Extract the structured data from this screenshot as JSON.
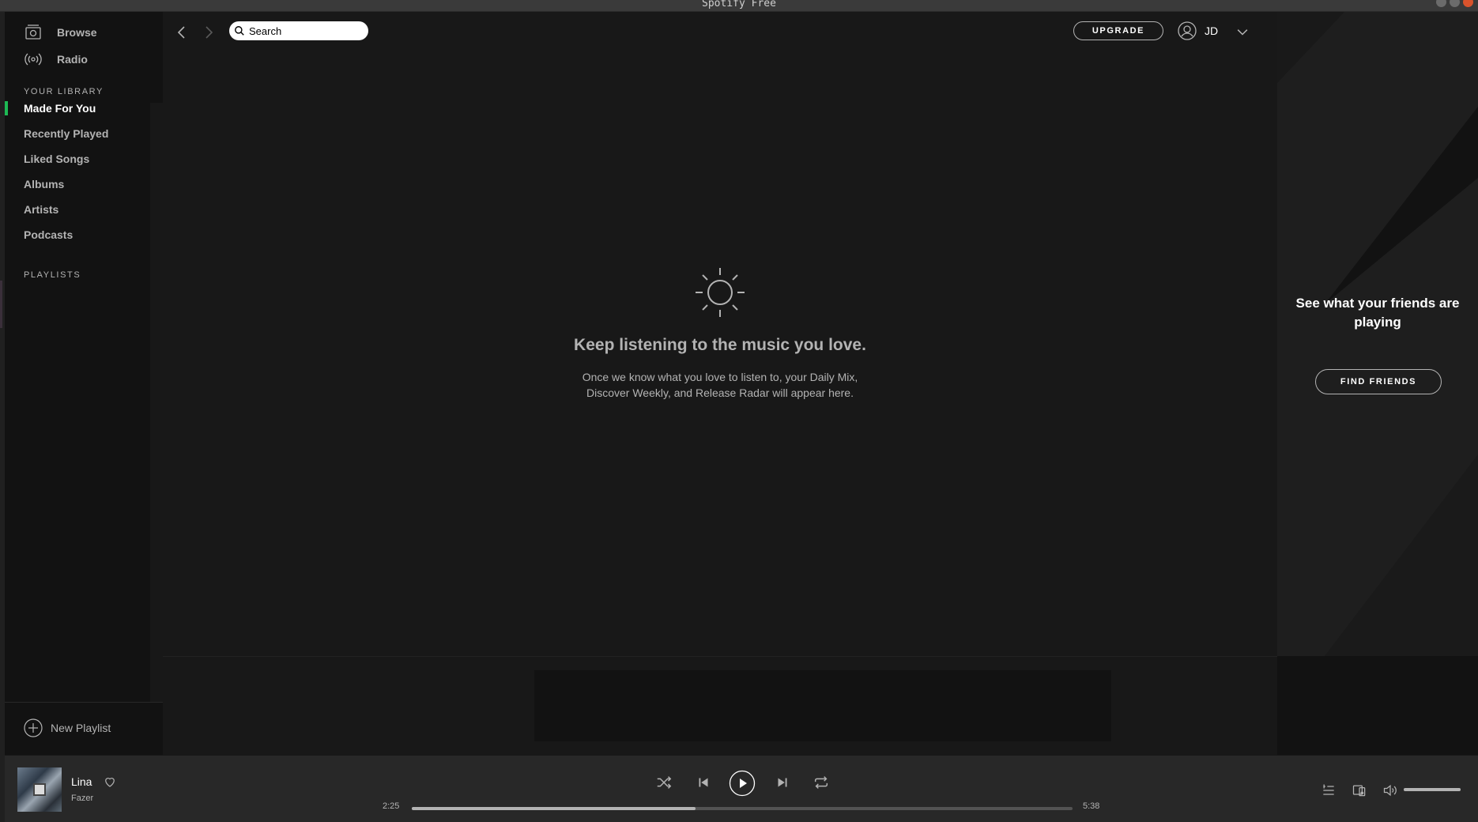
{
  "window": {
    "title": "Spotify Free"
  },
  "sidebar": {
    "nav": [
      {
        "label": "Browse",
        "icon": "browse-icon"
      },
      {
        "label": "Radio",
        "icon": "radio-icon"
      }
    ],
    "library_heading": "YOUR LIBRARY",
    "library_items": [
      {
        "label": "Made For You",
        "active": true
      },
      {
        "label": "Recently Played",
        "active": false
      },
      {
        "label": "Liked Songs",
        "active": false
      },
      {
        "label": "Albums",
        "active": false
      },
      {
        "label": "Artists",
        "active": false
      },
      {
        "label": "Podcasts",
        "active": false
      }
    ],
    "playlists_heading": "PLAYLISTS",
    "new_playlist_label": "New Playlist"
  },
  "topbar": {
    "search_placeholder": "Search",
    "upgrade_label": "UPGRADE",
    "user_name": "JD"
  },
  "main": {
    "empty_title": "Keep listening to the music you love.",
    "empty_body_line1": "Once we know what you love to listen to, your Daily Mix,",
    "empty_body_line2": "Discover Weekly, and Release Radar will appear here."
  },
  "friends_panel": {
    "title_line1": "See what your friends are",
    "title_line2": "playing",
    "button_label": "FIND FRIENDS"
  },
  "player": {
    "track_title": "Lina",
    "track_artist": "Fazer",
    "elapsed": "2:25",
    "duration": "5:38",
    "progress_fraction": 0.43,
    "volume_fraction": 1.0
  },
  "colors": {
    "accent": "#1db954",
    "background": "#121212",
    "main_background": "#181818",
    "player_background": "#282828"
  }
}
